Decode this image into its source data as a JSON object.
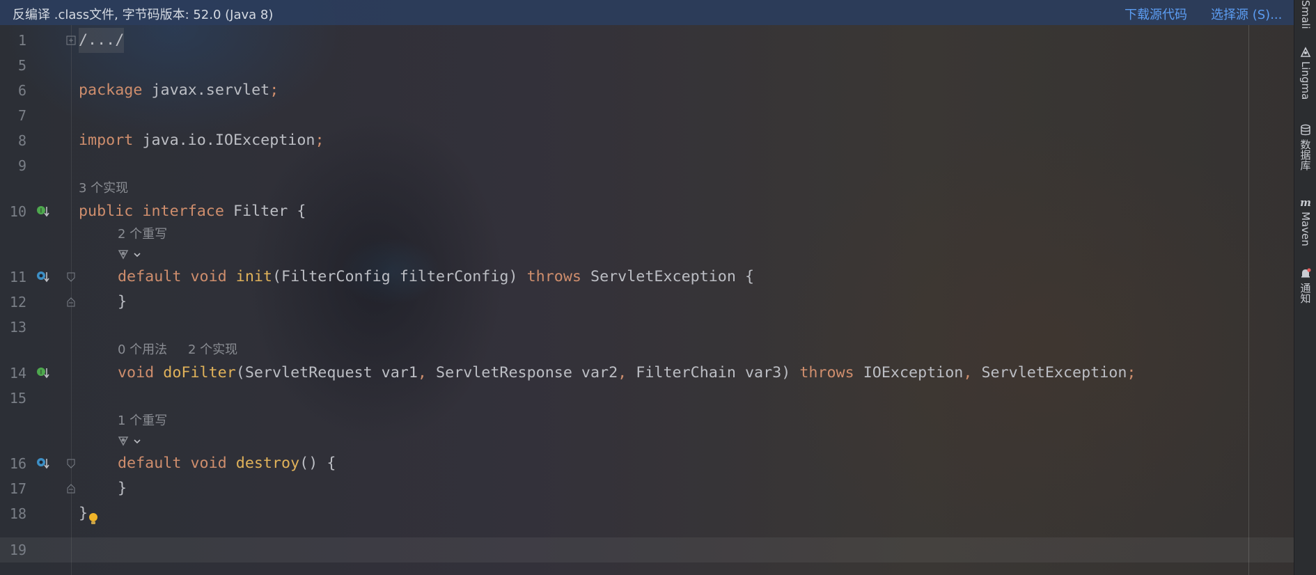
{
  "banner": {
    "title": "反编译 .class文件, 字节码版本: 52.0 (Java 8)",
    "download_source": "下载源代码",
    "choose_source": "选择源 (S)..."
  },
  "editor": {
    "line_numbers": [
      "1",
      "5",
      "6",
      "7",
      "8",
      "9",
      "10",
      "11",
      "12",
      "13",
      "14",
      "15",
      "16",
      "17",
      "18",
      "19"
    ],
    "collapsed_header": "/.../",
    "package_kw": "package",
    "package_name": " javax.servlet",
    "import_kw": "import",
    "import_name": " java.io.IOException",
    "semicolon": ";",
    "hint_implementations_3": "3 个实现",
    "hint_overrides_2": "2 个重写",
    "hint_usages_0": "0 个用法",
    "hint_implementations_2": "2 个实现",
    "hint_overrides_1": "1 个重写",
    "kw_public": "public",
    "kw_interface": "interface",
    "kw_default": "default",
    "kw_void": "void",
    "kw_throws": "throws",
    "interface_name": " Filter {",
    "init_name": "init",
    "init_params": "(FilterConfig filterConfig) ",
    "init_throws_rest": " ServletException {",
    "close_brace": "}",
    "dofilter_name": "doFilter",
    "dofilter_p1": "(ServletRequest var1",
    "dofilter_p2": " ServletResponse var2",
    "dofilter_p3": " FilterChain var3) ",
    "dofilter_e1": " IOException",
    "dofilter_e2": " ServletException",
    "comma": ",",
    "destroy_name": "destroy",
    "destroy_rest": "() {",
    "space": " "
  },
  "sidebar": {
    "items": [
      "Smali",
      "Lingma",
      "数据库",
      "Maven",
      "通知"
    ]
  },
  "colors": {
    "keyword": "#cf8e6d",
    "method": "#e0b25a",
    "link": "#5c9df2",
    "implemented_icon": "#4ea84e",
    "override_icon": "#3d8fc5"
  }
}
